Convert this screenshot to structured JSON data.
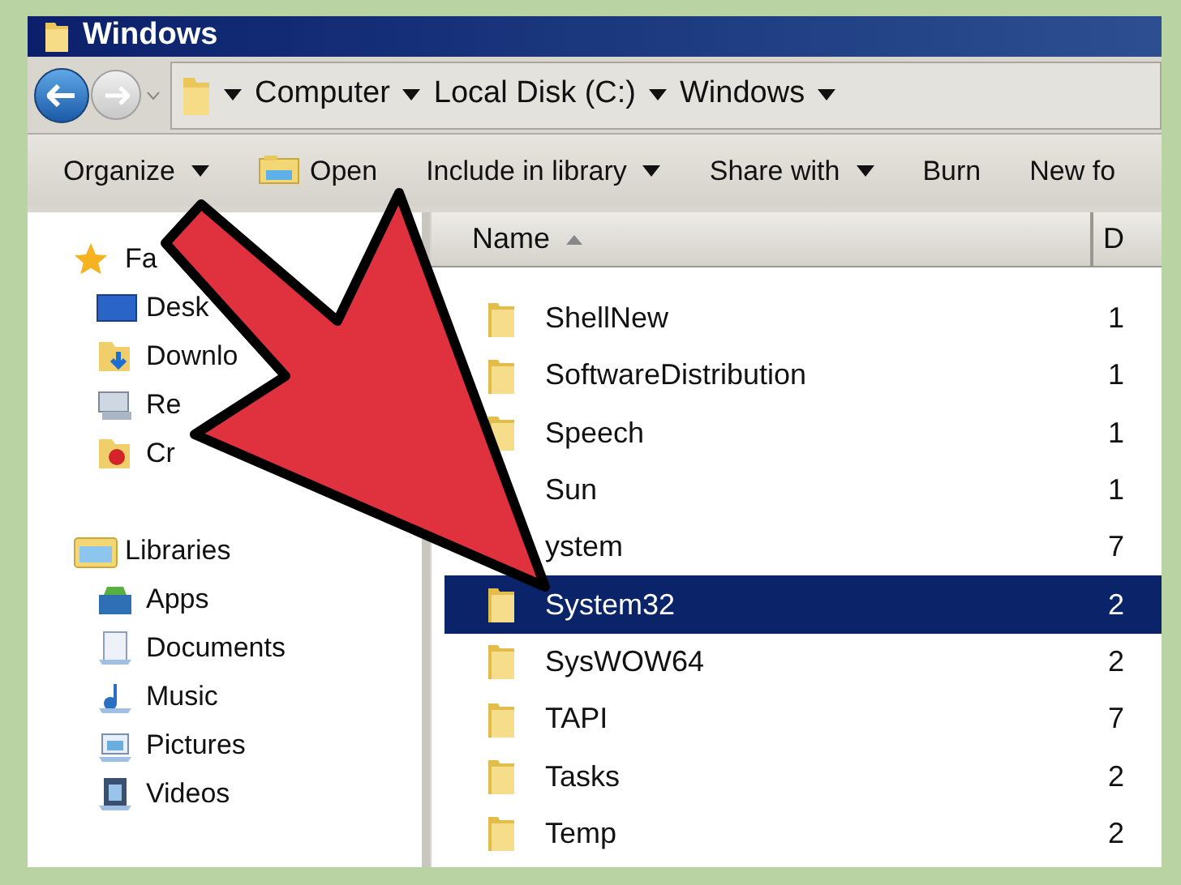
{
  "window": {
    "title": "Windows"
  },
  "address_bar": {
    "breadcrumbs": [
      "Computer",
      "Local Disk (C:)",
      "Windows"
    ]
  },
  "toolbar": [
    {
      "label": "Organize",
      "kind": "menu"
    },
    {
      "label": "Open",
      "kind": "open"
    },
    {
      "label": "Include in library",
      "kind": "menu"
    },
    {
      "label": "Share with",
      "kind": "menu"
    },
    {
      "label": "Burn",
      "kind": "plain"
    },
    {
      "label": "New fo",
      "kind": "plain"
    }
  ],
  "navigation": [
    {
      "label": "Fa",
      "kind": "favorites",
      "children": [
        {
          "label": "Desk",
          "kind": "desktop"
        },
        {
          "label": "Downlo",
          "kind": "downloads"
        },
        {
          "label": "Re",
          "kind": "recent"
        },
        {
          "label": "Cr",
          "kind": "creative"
        }
      ]
    },
    {
      "label": "Libraries",
      "kind": "libraries",
      "children": [
        {
          "label": "Apps",
          "kind": "apps"
        },
        {
          "label": "Documents",
          "kind": "documents"
        },
        {
          "label": "Music",
          "kind": "music"
        },
        {
          "label": "Pictures",
          "kind": "pictures"
        },
        {
          "label": "Videos",
          "kind": "videos"
        }
      ]
    }
  ],
  "file_list": {
    "columns": [
      "Name",
      "D"
    ],
    "rows": [
      {
        "name": "ShellNew",
        "column_2": "1",
        "selected": false,
        "icon": true
      },
      {
        "name": "SoftwareDistribution",
        "column_2": "1",
        "selected": false,
        "icon": true
      },
      {
        "name": "Speech",
        "column_2": "1",
        "selected": false,
        "icon": true
      },
      {
        "name": "Sun",
        "column_2": "1",
        "selected": false,
        "icon": false
      },
      {
        "name": "ystem",
        "column_2": "7",
        "selected": false,
        "icon": false
      },
      {
        "name": "System32",
        "column_2": "2",
        "selected": true,
        "icon": true
      },
      {
        "name": "SysWOW64",
        "column_2": "2",
        "selected": false,
        "icon": true
      },
      {
        "name": "TAPI",
        "column_2": "7",
        "selected": false,
        "icon": true
      },
      {
        "name": "Tasks",
        "column_2": "2",
        "selected": false,
        "icon": true
      },
      {
        "name": "Temp",
        "column_2": "2",
        "selected": false,
        "icon": true
      }
    ]
  }
}
